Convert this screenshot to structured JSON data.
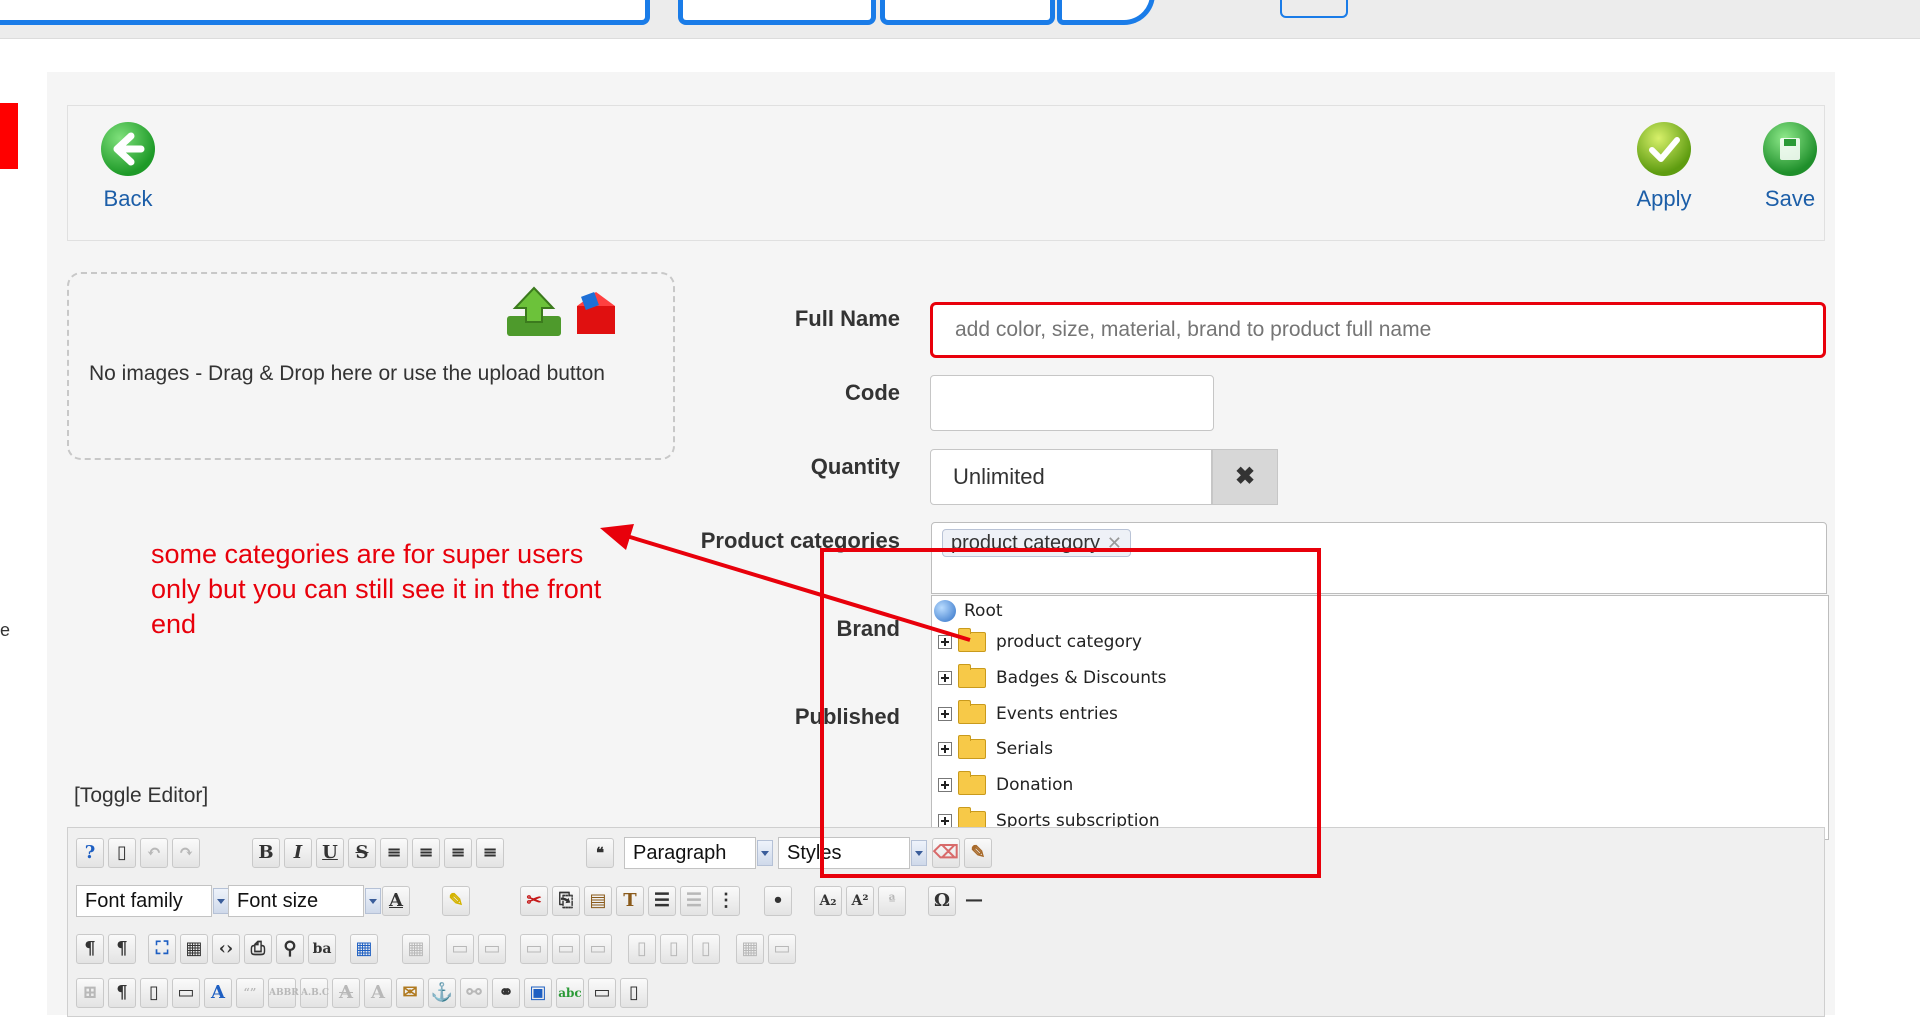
{
  "toolbar": {
    "back_label": "Back",
    "apply_label": "Apply",
    "save_label": "Save"
  },
  "upload": {
    "text": "No images - Drag & Drop here or use the upload button"
  },
  "form": {
    "full_name_label": "Full Name",
    "full_name_placeholder": "add color, size, material, brand to product full name",
    "code_label": "Code",
    "quantity_label": "Quantity",
    "quantity_value": "Unlimited",
    "categories_label": "Product categories",
    "categories_token": "product category",
    "brand_label": "Brand",
    "published_label": "Published"
  },
  "tree": {
    "root": "Root",
    "items": [
      "product category",
      "Badges & Discounts",
      "Events entries",
      "Serials",
      "Donation",
      "Sports subscription"
    ]
  },
  "annotation": {
    "text": "some categories are for super users only but you can still see it in the front end"
  },
  "editor": {
    "toggle_label": "[Toggle Editor]",
    "format_select": "Paragraph",
    "styles_select": "Styles",
    "font_family": "Font family",
    "font_size": "Font size"
  },
  "colors": {
    "accent_red": "#e8000b",
    "link_blue": "#1c5ea8",
    "topbar_blue": "#1a7ce8"
  }
}
